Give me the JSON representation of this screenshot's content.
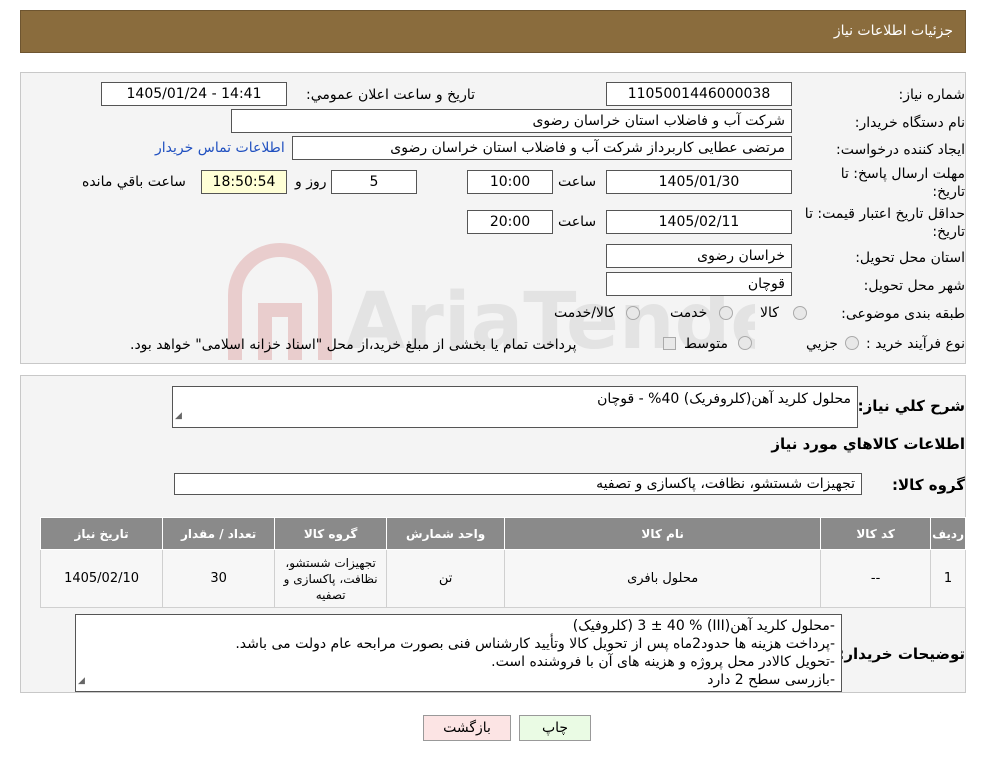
{
  "header": {
    "title": "جزئیات اطلاعات نیاز"
  },
  "form": {
    "need_number_label": "شماره نیاز:",
    "need_number": "1105001446000038",
    "announce_label": "تاریخ و ساعت اعلان عمومي:",
    "announce_value": "1405/01/24 - 14:41",
    "buyer_org_label": "نام دستگاه خریدار:",
    "buyer_org": "شرکت آب و فاضلاب استان خراسان رضوی",
    "creator_label": "ایجاد کننده درخواست:",
    "creator": "مرتضی عطایی کاربرداز شرکت آب و فاضلاب استان خراسان رضوی",
    "contact_link": "اطلاعات تماس خریدار",
    "deadline_label_1": "مهلت ارسال پاسخ: تا",
    "deadline_label_2": "تاریخ:",
    "deadline_date": "1405/01/30",
    "time_label": "ساعت",
    "deadline_time": "10:00",
    "days_value": "5",
    "days_label": "روز و",
    "remaining_time": "18:50:54",
    "remaining_label": "ساعت باقي مانده",
    "validity_label_1": "حداقل تاریخ اعتبار قیمت: تا",
    "validity_label_2": "تاریخ:",
    "validity_date": "1405/02/11",
    "validity_time": "20:00",
    "province_label": "استان محل تحویل:",
    "province": "خراسان رضوی",
    "city_label": "شهر محل تحویل:",
    "city": "قوچان",
    "category_label": "طبقه بندی موضوعی:",
    "category_options": [
      "کالا",
      "خدمت",
      "کالا/خدمت"
    ],
    "process_label": "نوع فرآیند خرید :",
    "process_options": [
      "جزیي",
      "متوسط"
    ],
    "process_note": "پرداخت تمام یا بخشی از مبلغ خرید،از محل \"اسناد خزانه اسلامی\" خواهد بود."
  },
  "summary": {
    "description_label": "شرح کلي نیاز:",
    "description": "محلول کلرید آهن(کلروفریک) 40% - قوچان",
    "items_title": "اطلاعات کالاهاي مورد نیاز",
    "group_label": "گروه کالا:",
    "group_value": "تجهیزات شستشو، نظافت، پاکسازی و تصفیه"
  },
  "table": {
    "headers": [
      "ردیف",
      "کد کالا",
      "نام کالا",
      "واحد شمارش",
      "گروه کالا",
      "تعداد / مقدار",
      "تاریخ نیاز"
    ],
    "rows": [
      [
        "1",
        "--",
        "محلول بافری",
        "تن",
        "تجهیزات شستشو، نظافت، پاکسازی و تصفیه",
        "30",
        "1405/02/10"
      ]
    ]
  },
  "notes": {
    "label": "توضیحات خریدار:",
    "lines": [
      "-محلول کلرید آهن(III) % 3 ± 40 (کلروفیک)",
      "-پرداخت هزینه ها حدود2ماه پس از تحویل کالا وتأیید کارشناس فنی بصورت مرابحه عام دولت می باشد.",
      "-تحویل کالادر محل پروژه و هزینه های آن با فروشنده است.",
      "-بازرسی سطح 2 دارد"
    ]
  },
  "buttons": {
    "print": "چاپ",
    "back": "بازگشت"
  },
  "watermark": {
    "text": "AriaTender.neT"
  }
}
